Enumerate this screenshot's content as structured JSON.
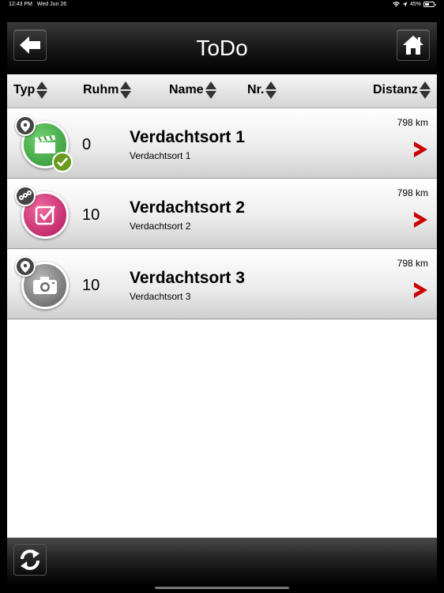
{
  "status": {
    "time": "12:43 PM",
    "date": "Wed Jun 26",
    "battery": "45%"
  },
  "header": {
    "title": "ToDo"
  },
  "columns": {
    "typ": "Typ",
    "ruhm": "Ruhm",
    "name": "Name",
    "nr": "Nr.",
    "distanz": "Distanz"
  },
  "rows": [
    {
      "ruhm": "0",
      "name": "Verdachtsort 1",
      "subtitle": "Verdachtsort 1",
      "distance": "798 km",
      "type_icon": "clapperboard-icon",
      "badge_icon": "map-pin-icon",
      "completed": true,
      "color": "#3aa63a"
    },
    {
      "ruhm": "10",
      "name": "Verdachtsort 2",
      "subtitle": "Verdachtsort 2",
      "distance": "798 km",
      "type_icon": "checkbox-icon",
      "badge_icon": "multi-pin-icon",
      "completed": false,
      "color": "#c8246a"
    },
    {
      "ruhm": "10",
      "name": "Verdachtsort 3",
      "subtitle": "Verdachtsort 3",
      "distance": "798 km",
      "type_icon": "camera-icon",
      "badge_icon": "map-pin-icon",
      "completed": false,
      "color": "#7a7a7a"
    }
  ],
  "colors": {
    "chevron": "#cc0000",
    "header_bg": "#000000"
  }
}
